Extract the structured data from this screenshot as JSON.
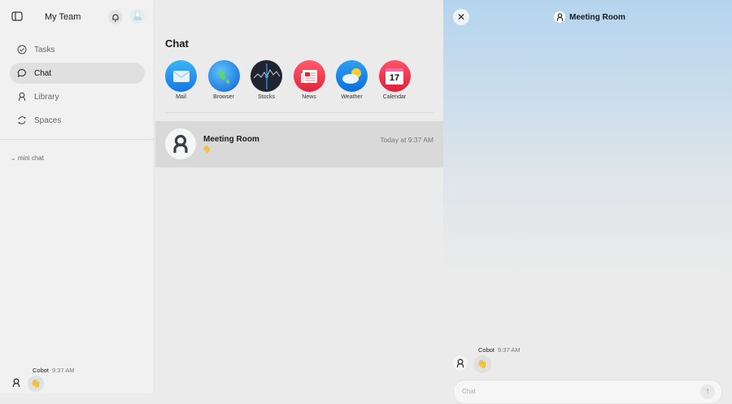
{
  "sidebar": {
    "team": "My Team",
    "items": [
      {
        "label": "Tasks"
      },
      {
        "label": "Chat"
      },
      {
        "label": "Library"
      },
      {
        "label": "Spaces"
      }
    ],
    "mini_chat": "mini chat",
    "message": {
      "sender": "Cobot",
      "time": "9:37 AM",
      "emoji": "👋"
    }
  },
  "middle": {
    "title": "Chat",
    "apps": [
      {
        "label": "Mail"
      },
      {
        "label": "Browser"
      },
      {
        "label": "Stocks"
      },
      {
        "label": "News"
      },
      {
        "label": "Weather"
      },
      {
        "label": "Calendar",
        "day": "17"
      }
    ],
    "conversation": {
      "name": "Meeting Room",
      "time": "Today at 9:37 AM",
      "preview": "👋"
    }
  },
  "panel": {
    "title": "Meeting Room",
    "message": {
      "sender": "Cobot",
      "time": "9:37 AM",
      "emoji": "👋"
    },
    "input_placeholder": "Chat"
  }
}
